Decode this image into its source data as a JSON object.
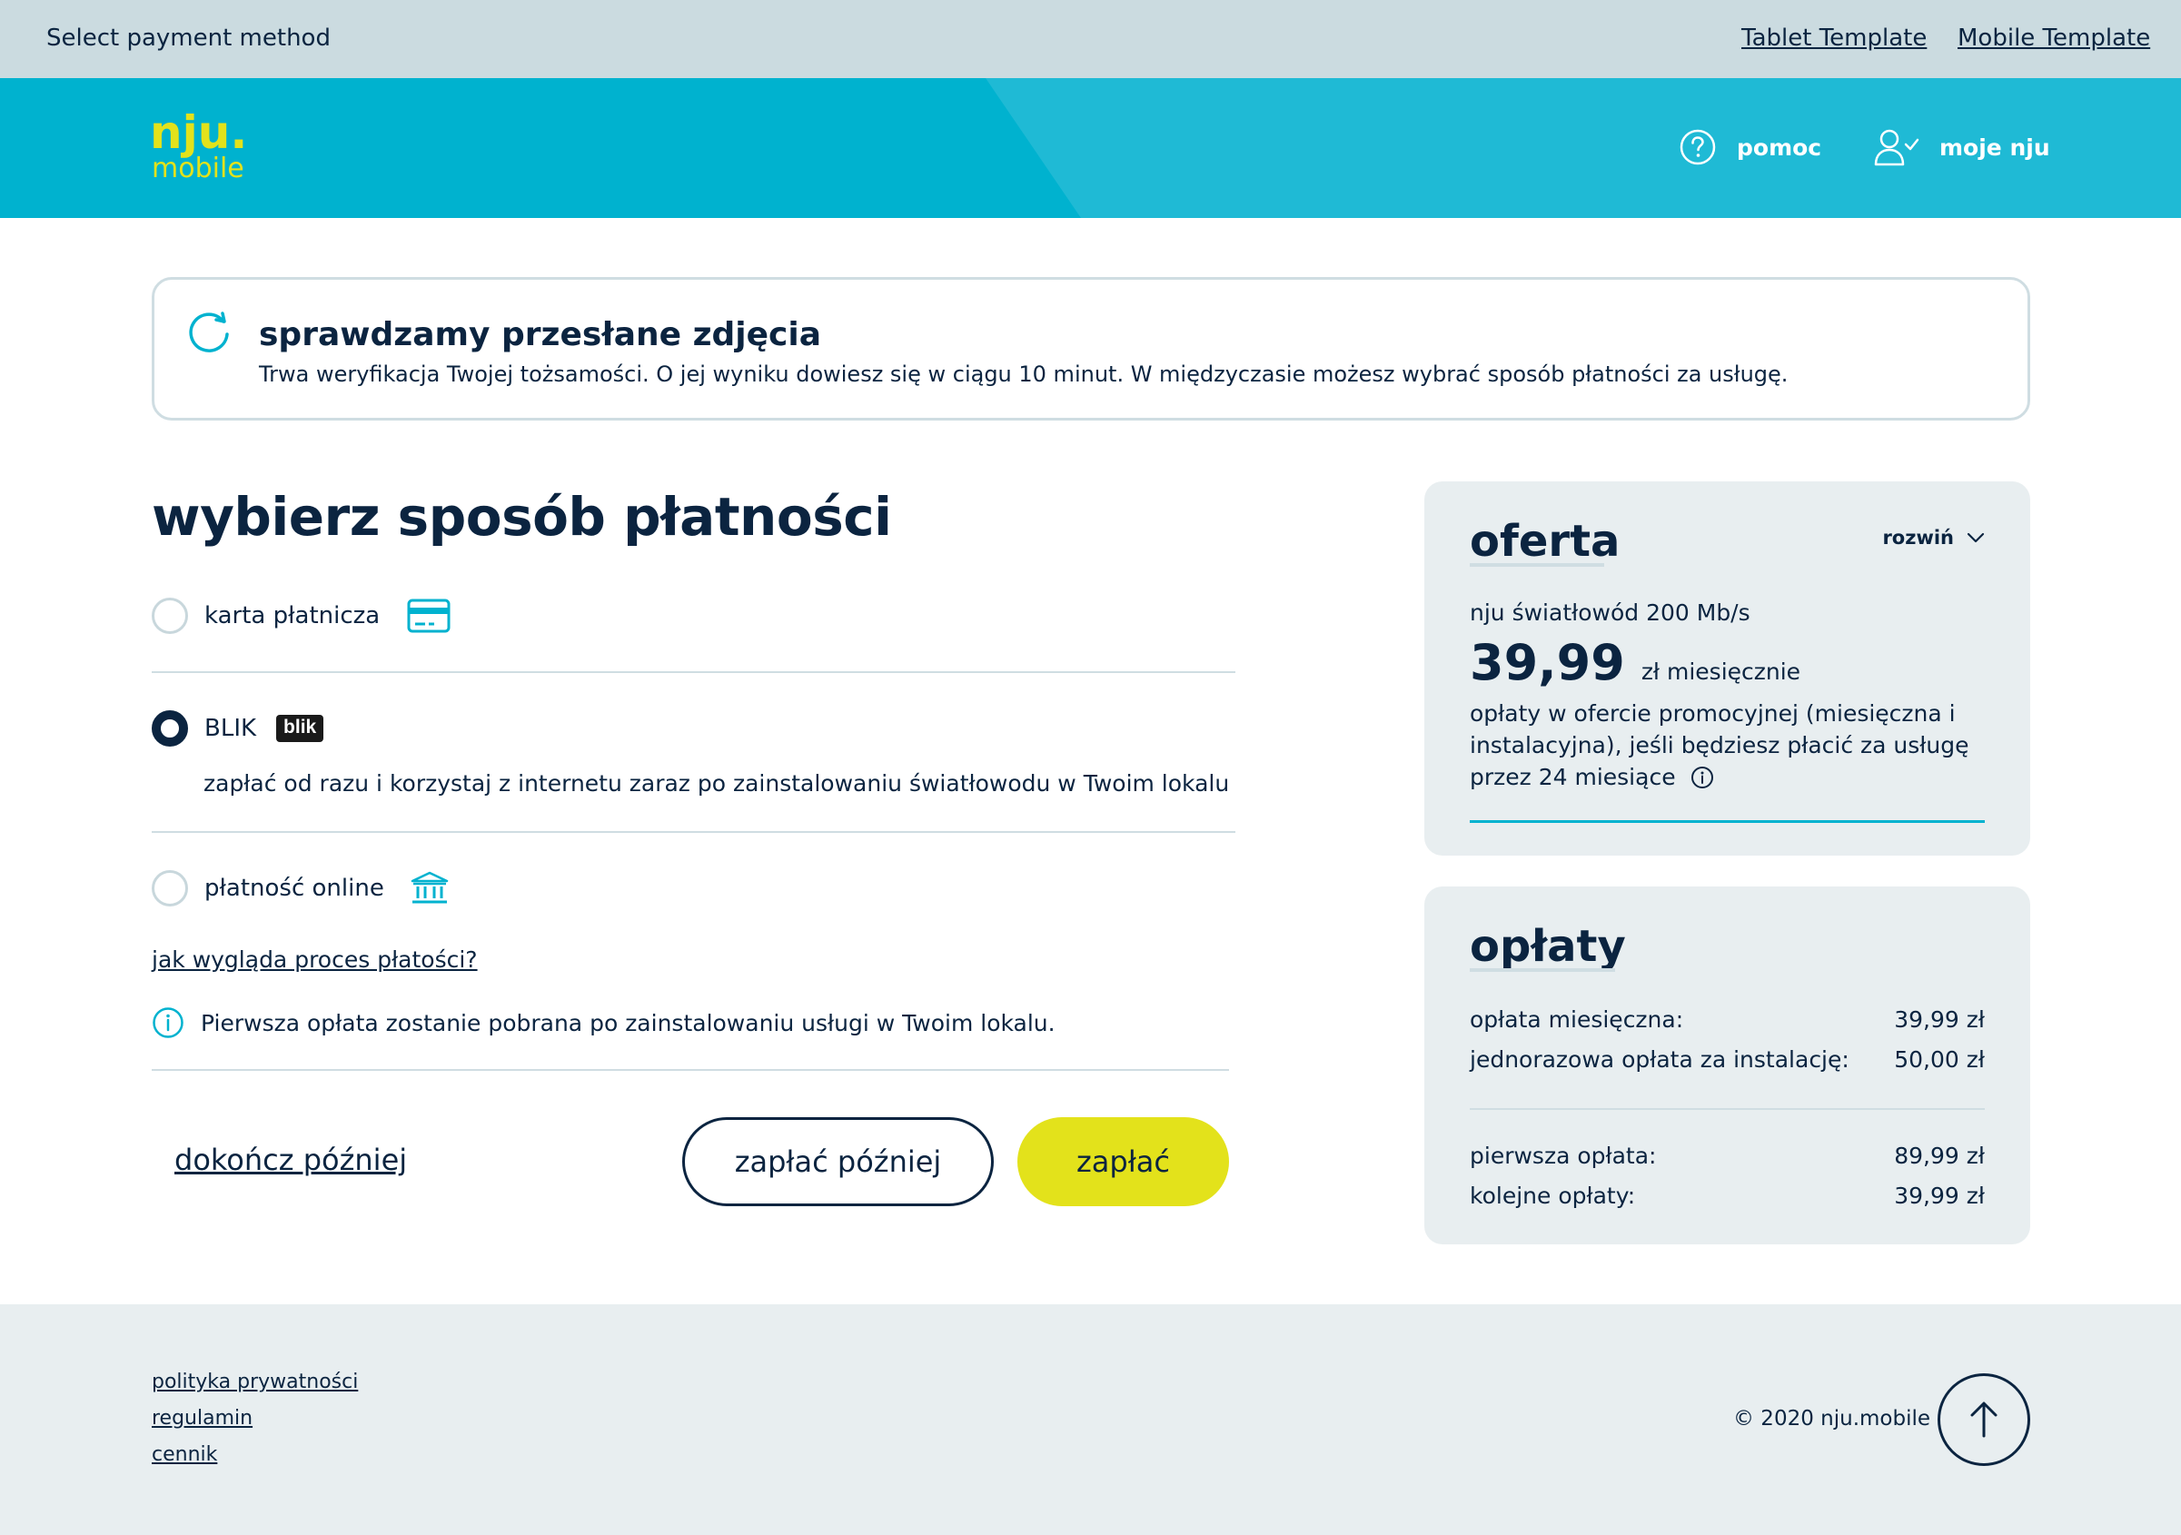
{
  "template_bar": {
    "title": "Select payment method",
    "links": [
      "Tablet Template",
      "Mobile Template"
    ]
  },
  "header": {
    "logo_top": "nju.",
    "logo_bottom": "mobile",
    "nav": [
      {
        "label": "pomoc",
        "icon": "help-circle-icon"
      },
      {
        "label": "moje nju",
        "icon": "user-check-icon"
      }
    ],
    "colors": {
      "primary": "#00b2cf",
      "secondary": "#1fbad5",
      "logo": "#e3e21b"
    }
  },
  "notice": {
    "icon": "refresh-icon",
    "title": "sprawdzamy przesłane zdjęcia",
    "text": "Trwa weryfikacja Twojej tożsamości. O jej wyniku dowiesz się w ciągu 10 minut. W międzyczasie możesz wybrać sposób płatności za usługę."
  },
  "payment": {
    "heading": "wybierz sposób płatności",
    "options": [
      {
        "label": "karta płatnicza",
        "icon": "credit-card-icon",
        "selected": false
      },
      {
        "label": "BLIK",
        "icon": "blik-logo",
        "badge": "blik",
        "selected": true,
        "description": "zapłać od razu i korzystaj z internetu zaraz po zainstalowaniu światłowodu w Twoim lokalu"
      },
      {
        "label": "płatność online",
        "icon": "bank-icon",
        "selected": false
      }
    ],
    "process_link": "jak wygląda proces płatości?",
    "info": "Pierwsza opłata zostanie pobrana po zainstalowaniu usługi w Twoim lokalu.",
    "finish_later": "dokończ później",
    "pay_later": "zapłać później",
    "pay": "zapłać"
  },
  "offer": {
    "title": "oferta",
    "expand_label": "rozwiń",
    "name": "nju światłowód 200 Mb/s",
    "price": "39,99",
    "price_unit": "zł miesięcznie",
    "description": "opłaty w ofercie promocyjnej (miesięczna i instalacyjna), jeśli będziesz płacić za usługę przez 24 miesiące"
  },
  "fees": {
    "title": "opłaty",
    "rows": [
      {
        "label": "opłata miesięczna:",
        "value": "39,99 zł"
      },
      {
        "label": "jednorazowa opłata za instalację:",
        "value": "50,00 zł"
      },
      {
        "label": "pierwsza opłata:",
        "value": "89,99 zł"
      },
      {
        "label": "kolejne opłaty:",
        "value": "39,99 zł"
      }
    ]
  },
  "footer": {
    "links": [
      "polityka prywatności",
      "regulamin",
      "cennik"
    ],
    "copyright": "© 2020 nju.mobile"
  }
}
